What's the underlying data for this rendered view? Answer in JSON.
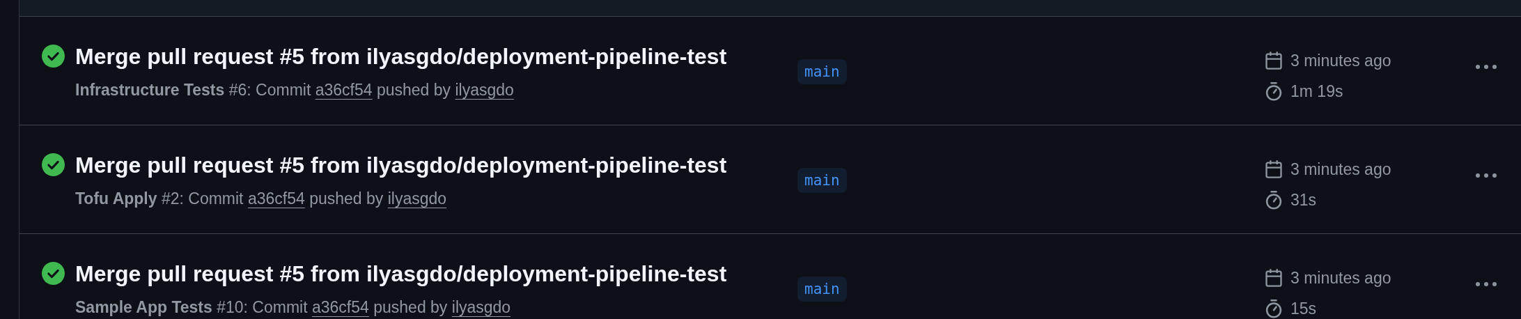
{
  "runs": [
    {
      "success": true,
      "title": "Merge pull request #5 from ilyasgdo/deployment-pipeline-test",
      "lead": "**Infrastructure Tests** #6: Commit",
      "commit": "a36cf54",
      "middle": "pushed by",
      "actor": "ilyasgdo",
      "branch": "main",
      "started": "3 minutes ago",
      "duration": "1m 19s"
    },
    {
      "success": true,
      "title": "Merge pull request #5 from ilyasgdo/deployment-pipeline-test",
      "lead": "**Tofu Apply** #2: Commit",
      "commit": "a36cf54",
      "middle": "pushed by",
      "actor": "ilyasgdo",
      "branch": "main",
      "started": "3 minutes ago",
      "duration": "31s"
    },
    {
      "success": true,
      "title": "Merge pull request #5 from ilyasgdo/deployment-pipeline-test",
      "lead": "**Sample App Tests** #10: Commit",
      "commit": "a36cf54",
      "middle": "pushed by",
      "actor": "ilyasgdo",
      "branch": "main",
      "started": "3 minutes ago",
      "duration": "15s"
    }
  ]
}
